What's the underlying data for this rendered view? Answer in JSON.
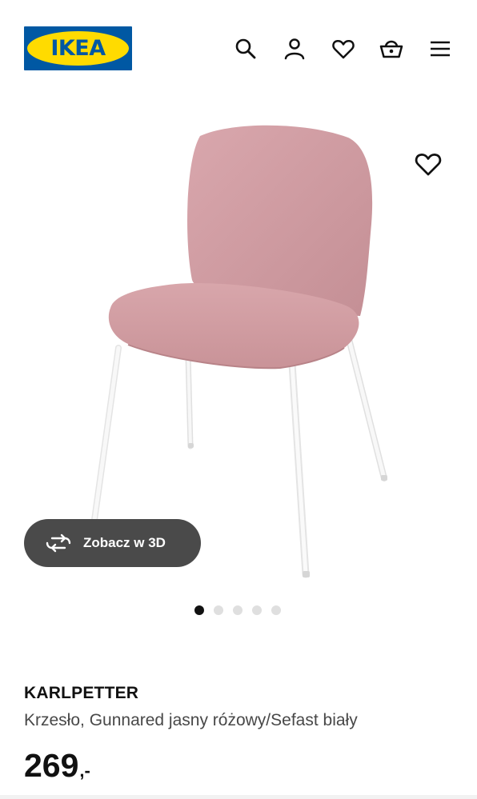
{
  "brand": {
    "logo_text": "IKEA",
    "blue": "#0058a3",
    "yellow": "#ffdb00"
  },
  "header_icons": [
    "search-icon",
    "user-icon",
    "heart-icon",
    "basket-icon",
    "menu-icon"
  ],
  "gallery": {
    "favorite_icon": "heart-icon",
    "view3d_label": "Zobacz w 3D",
    "view3d_icon": "rotate-icon",
    "slide_count": 5,
    "active_slide": 1
  },
  "product": {
    "name": "KARLPETTER",
    "description": "Krzesło, Gunnared jasny różowy/Sefast biały",
    "price_integer": "269",
    "price_decimal": ",-"
  },
  "colors": {
    "text": "#111111",
    "secondary_text": "#484848",
    "chair_fabric": "#d4a2a7",
    "pill_bg": "#4a4a4a"
  }
}
